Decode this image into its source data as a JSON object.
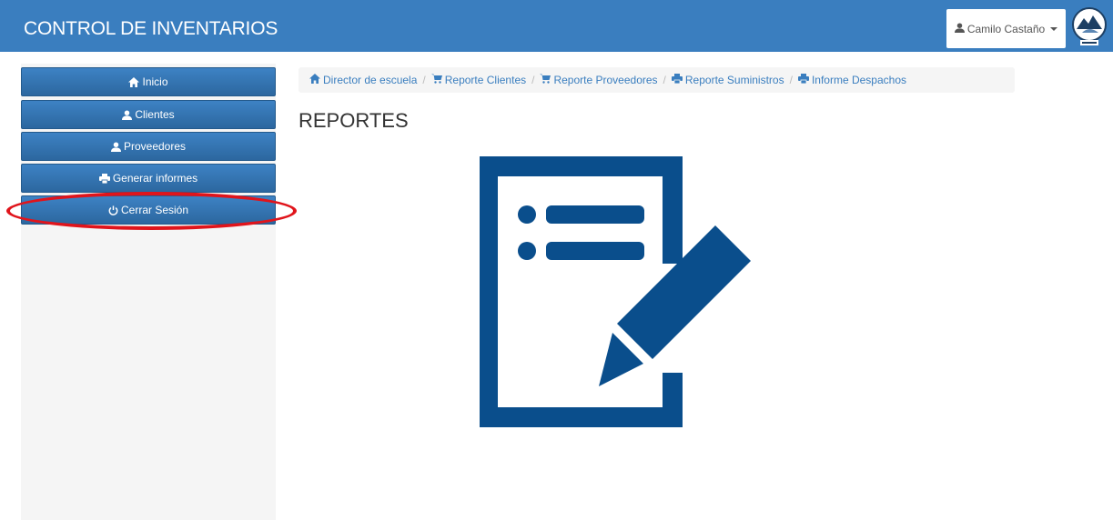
{
  "app": {
    "title": "CONTROL DE INVENTARIOS"
  },
  "user": {
    "name": "Camilo Castaño"
  },
  "sidebar": {
    "items": [
      {
        "label": "Inicio",
        "icon": "home-icon"
      },
      {
        "label": "Clientes",
        "icon": "user-icon"
      },
      {
        "label": "Proveedores",
        "icon": "user-icon"
      },
      {
        "label": "Generar informes",
        "icon": "print-icon"
      },
      {
        "label": "Cerrar Sesión",
        "icon": "power-icon"
      }
    ]
  },
  "breadcrumb": [
    {
      "label": "Director de escuela",
      "icon": "home-icon"
    },
    {
      "label": "Reporte Clientes",
      "icon": "cart-icon"
    },
    {
      "label": "Reporte Proveedores",
      "icon": "cart-icon"
    },
    {
      "label": "Reporte Suministros",
      "icon": "print-icon"
    },
    {
      "label": "Informe Despachos",
      "icon": "print-icon"
    }
  ],
  "main": {
    "title": "REPORTES"
  },
  "colors": {
    "navbar": "#3a7ebf",
    "sidebar_button": "#2c679f",
    "report_icon": "#0a4e8c",
    "highlight": "#e0141b"
  }
}
